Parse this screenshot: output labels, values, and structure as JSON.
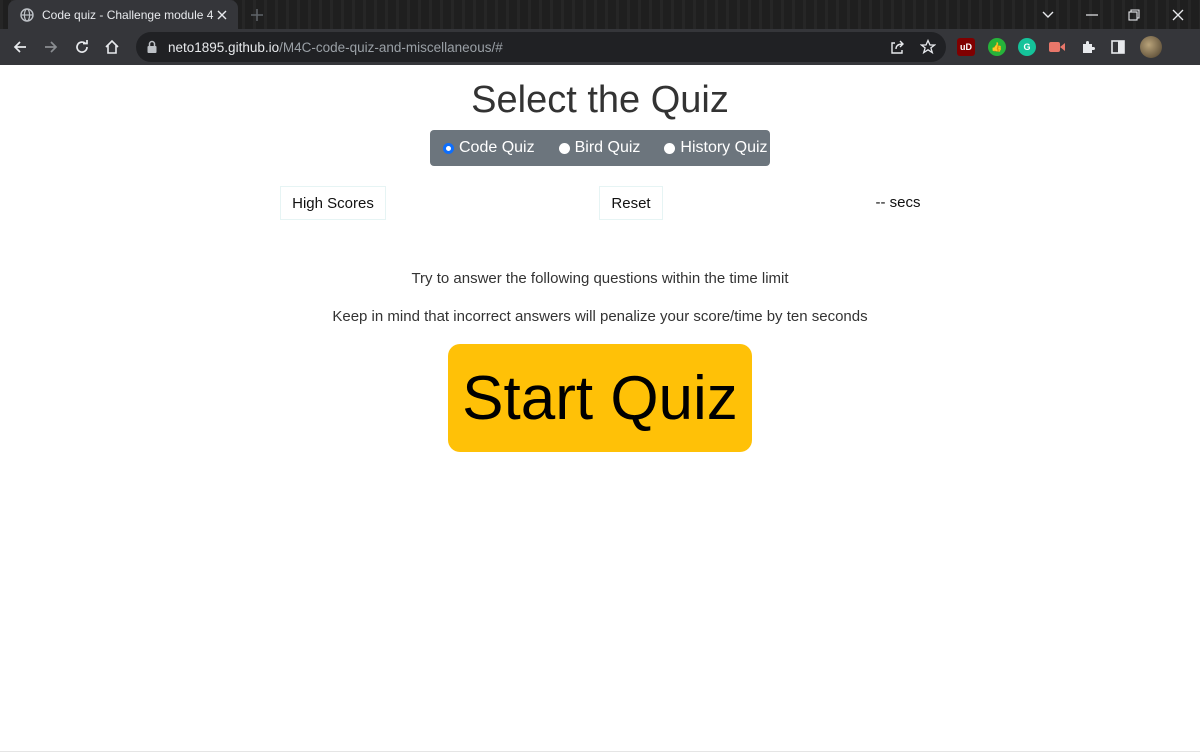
{
  "browser": {
    "tab_title": "Code quiz - Challenge module 4",
    "url_host": "neto1895.github.io",
    "url_path": "/M4C-code-quiz-and-miscellaneous/#",
    "extensions": [
      "ublock-origin",
      "thumbs-up-extension",
      "grammarly",
      "video-extension",
      "extensions-puzzle",
      "side-panel",
      "profile-avatar"
    ]
  },
  "page": {
    "title": "Select the Quiz",
    "quiz_options": [
      {
        "label": "Code Quiz",
        "checked": true
      },
      {
        "label": "Bird Quiz",
        "checked": false
      },
      {
        "label": "History Quiz",
        "checked": false
      }
    ],
    "high_scores_label": "High Scores",
    "reset_label": "Reset",
    "timer_text": "-- secs",
    "instruction_1": "Try to answer the following questions within the time limit",
    "instruction_2": "Keep in mind that incorrect answers will penalize your score/time by ten seconds",
    "start_label": "Start Quiz"
  },
  "colors": {
    "start_button": "#ffc107",
    "quiz_select_bg": "#6c757d",
    "radio_checked": "#0d6efd"
  }
}
